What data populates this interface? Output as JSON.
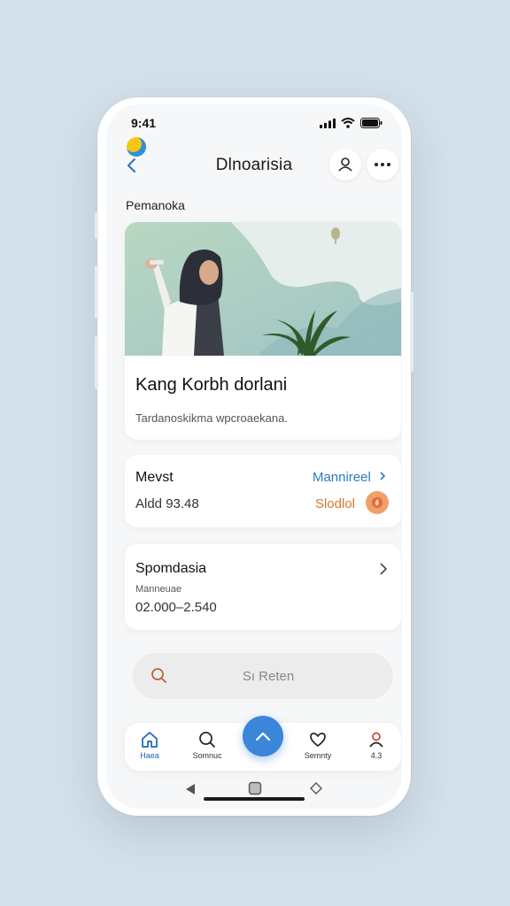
{
  "status_bar": {
    "time": "9:41"
  },
  "header": {
    "title": "Dlnoarisia",
    "icons": [
      "back-chevron",
      "person-outline",
      "ellipsis-horizontal"
    ]
  },
  "section_label": "Pemanoka",
  "hero_card": {
    "title": "Kang Korbh dorlani",
    "subtitle": "Tardanoskikma wpcroaekana."
  },
  "row_card": {
    "label": "Mevst",
    "link_label": "Mannireel",
    "value": "Aldd 93.48",
    "amount": "Slodlol",
    "colors": {
      "link": "#2b7bbf",
      "amount": "#d9782d",
      "badge": "#f0a06a"
    }
  },
  "info_card": {
    "label": "Spomdasia",
    "caption": "Manneuae",
    "phone": "02.000–2.540"
  },
  "search": {
    "placeholder": "Sı Reten"
  },
  "tabbar": {
    "tabs": [
      {
        "label": "Haea",
        "icon": "home-icon",
        "active": true
      },
      {
        "label": "Somnuc",
        "icon": "search-icon"
      },
      {
        "label": "",
        "icon": "chevron-up-icon"
      },
      {
        "label": "Semnty",
        "icon": "heart-icon"
      },
      {
        "label": "4.3",
        "icon": "person-icon"
      }
    ],
    "accent": "#3b86da"
  }
}
